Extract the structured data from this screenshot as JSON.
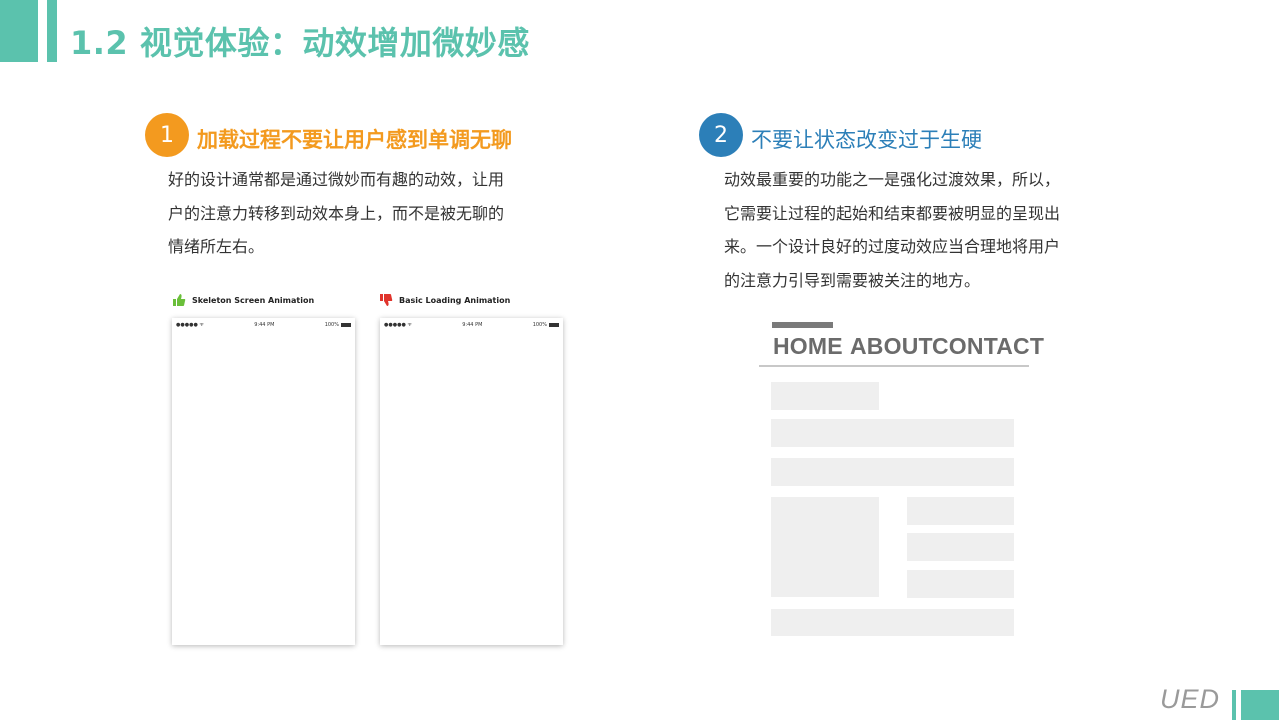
{
  "header": {
    "title": "1.2 视觉体验：动效增加微妙感"
  },
  "sections": [
    {
      "number": "1",
      "title": "加载过程不要让用户感到单调无聊",
      "lines": [
        "好的设计通常都是通过微妙而有趣的动效，让用",
        "户的注意力转移到动效本身上，而不是被无聊的",
        "情绪所左右。"
      ],
      "accent": "#f39a1f",
      "mockups": [
        {
          "label": "Skeleton Screen Animation",
          "icon": "thumbs-up-icon",
          "icon_color": "#6abf3a",
          "status_signal": "●●●●● ᯤ",
          "status_time": "9:44 PM",
          "status_battery": "100%"
        },
        {
          "label": "Basic Loading Animation",
          "icon": "thumbs-down-icon",
          "icon_color": "#e0342c",
          "status_signal": "●●●●● ᯤ",
          "status_time": "9:44 PM",
          "status_battery": "100%"
        }
      ]
    },
    {
      "number": "2",
      "title": "不要让状态改变过于生硬",
      "lines": [
        "动效最重要的功能之一是强化过渡效果，所以，",
        "它需要让过程的起始和结束都要被明显的呈现出",
        "来。一个设计良好的过度动效应当合理地将用户",
        "的注意力引导到需要被关注的地方。"
      ],
      "accent": "#2c7fb8",
      "wireframe": {
        "nav": [
          "HOME",
          "ABOUT",
          "CONTACT"
        ],
        "active": "HOME"
      }
    }
  ],
  "footer": {
    "logo": "UED"
  },
  "colors": {
    "brand": "#5bc2ad"
  }
}
